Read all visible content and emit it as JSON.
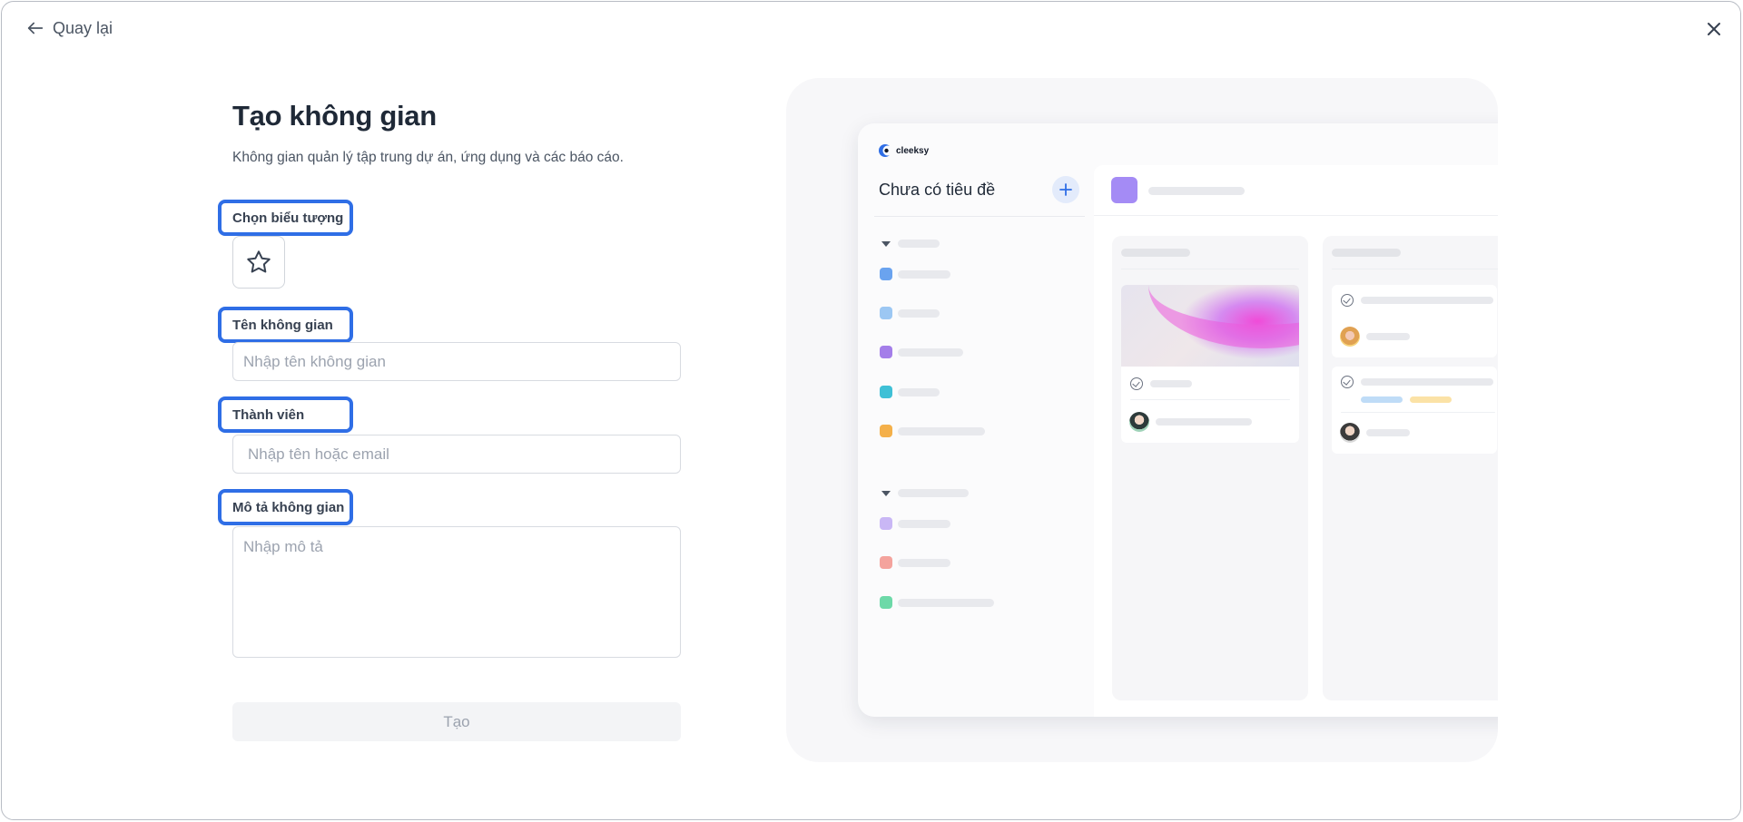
{
  "header": {
    "back_label": "Quay lại"
  },
  "form": {
    "title": "Tạo không gian",
    "subtitle": "Không gian quản lý tập trung dự án, ứng dụng và các báo cáo.",
    "icon_label": "Chọn biểu tượng",
    "icon_name": "star-icon",
    "name_label": "Tên không gian",
    "name_placeholder": "Nhập tên không gian",
    "name_value": "",
    "members_label": "Thành viên",
    "members_placeholder": "Nhập tên hoặc email",
    "members_value": "",
    "desc_label": "Mô tả không gian",
    "desc_placeholder": "Nhập mô tả",
    "desc_value": "",
    "submit_label": "Tạo"
  },
  "preview": {
    "logo_text": "cleeksy",
    "workspace_title": "Chưa có tiêu đề"
  },
  "colors": {
    "highlight": "#2f6ee6",
    "accent_purple": "#a48bf5",
    "plus_bg": "#e3ebfb"
  }
}
